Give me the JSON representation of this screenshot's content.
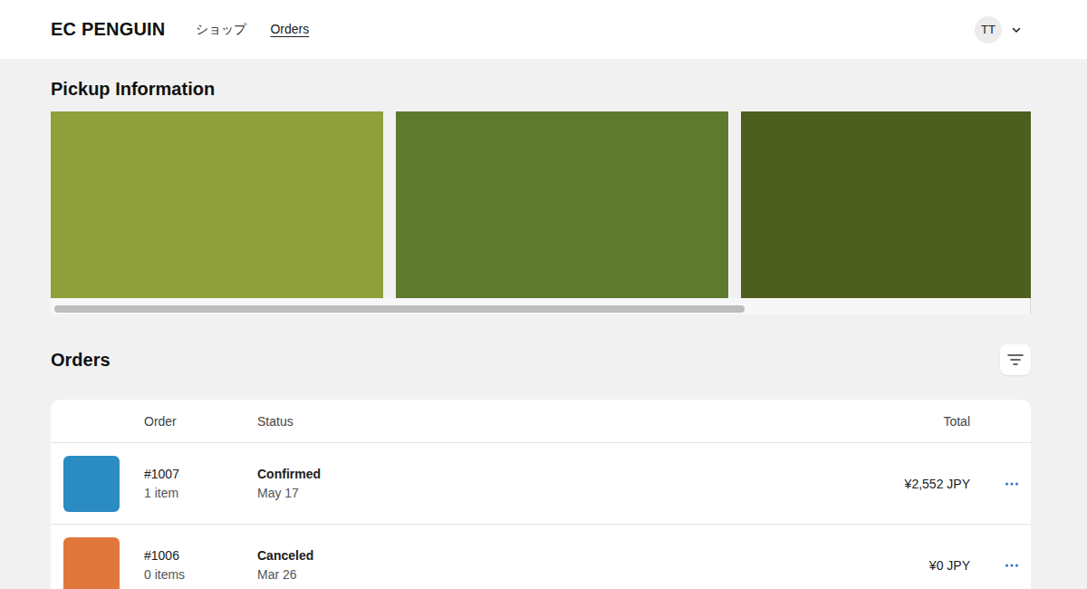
{
  "header": {
    "logo": "EC PENGUIN",
    "nav": [
      {
        "label": "ショップ",
        "selected": false
      },
      {
        "label": "Orders",
        "selected": true
      }
    ],
    "account": {
      "initials": "TT"
    }
  },
  "pickup": {
    "title": "Pickup Information",
    "banners": [
      {
        "color": "#8fa03a"
      },
      {
        "color": "#5e7a2e"
      },
      {
        "color": "#4e5e1e"
      }
    ],
    "scrollbar": {
      "level": 0.71
    }
  },
  "orders": {
    "title": "Orders",
    "columns": [
      "Order",
      "Status",
      "Total"
    ],
    "rows": [
      {
        "number": "#1007",
        "items": "1 item",
        "status": "Confirmed",
        "date": "May 17",
        "total": "¥2,552 JPY",
        "color": "#2b8cc4"
      },
      {
        "number": "#1006",
        "items": "0 items",
        "status": "Canceled",
        "date": "Mar 26",
        "total": "¥0 JPY",
        "color": "#e0773a"
      }
    ]
  }
}
